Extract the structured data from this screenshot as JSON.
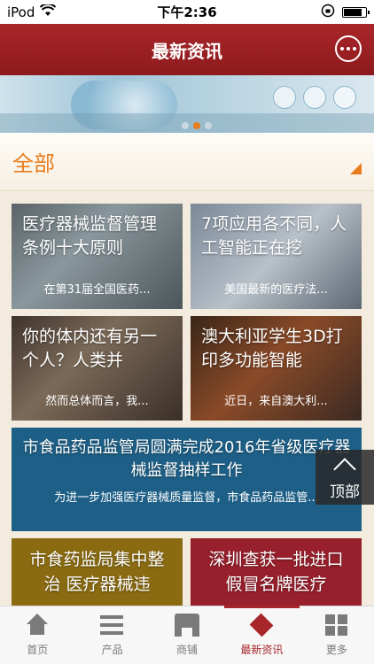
{
  "status_bar": {
    "carrier": "iPod",
    "time": "下午2:36"
  },
  "header": {
    "title": "最新资讯"
  },
  "banner": {
    "page_count": 3,
    "active_index": 1
  },
  "category": {
    "label": "全部"
  },
  "cards": [
    {
      "title": "医疗器械监督管理条例十大原则",
      "summary": "在第31届全国医药..."
    },
    {
      "title": "7项应用各不同，人工智能正在挖",
      "summary": "美国最新的医疗法..."
    },
    {
      "title": "你的体内还有另一个人？人类并",
      "summary": "然而总体而言，我..."
    },
    {
      "title": "澳大利亚学生3D打印多功能智能",
      "summary": "近日，来自澳大利..."
    },
    {
      "title": "市食品药品监管局圆满完成2016年省级医疗器械监督抽样工作",
      "summary": "为进一步加强医疗器械质量监督，市食品药品监管..."
    },
    {
      "title": "市食药监局集中整治 医疗器械违",
      "summary": ""
    },
    {
      "title": "深圳查获一批进口假冒名牌医疗",
      "summary": ""
    }
  ],
  "back_to_top": {
    "label": "顶部"
  },
  "tabbar": [
    {
      "label": "首页",
      "icon": "home-icon"
    },
    {
      "label": "产品",
      "icon": "list-icon"
    },
    {
      "label": "商铺",
      "icon": "shop-icon"
    },
    {
      "label": "最新资讯",
      "icon": "news-icon",
      "active": true
    },
    {
      "label": "更多",
      "icon": "grid-icon"
    }
  ],
  "colors": {
    "primary": "#a8262a",
    "accent": "#e87d1e",
    "card_blue": "#1d5f86",
    "card_olive": "#8a6b12",
    "card_red": "#97202c"
  }
}
